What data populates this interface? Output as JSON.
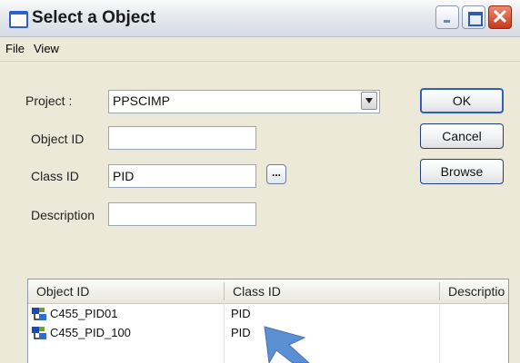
{
  "window": {
    "title": "Select a Object"
  },
  "menu": {
    "items": [
      "File",
      "View"
    ]
  },
  "form": {
    "project_label": "Project :",
    "project_value": "PPSCIMP",
    "object_id_label": "Object ID",
    "object_id_value": "",
    "class_id_label": "Class ID",
    "class_id_value": "PID",
    "description_label": "Description",
    "description_value": "",
    "ellipsis_label": "..."
  },
  "buttons": {
    "ok": "OK",
    "cancel": "Cancel",
    "browse": "Browse"
  },
  "list": {
    "columns": [
      "Object ID",
      "Class ID",
      "Descriptio"
    ],
    "rows": [
      {
        "object_id": "C455_PID01",
        "class_id": "PID",
        "description": ""
      },
      {
        "object_id": "C455_PID_100",
        "class_id": "PID",
        "description": ""
      }
    ]
  },
  "colors": {
    "window_face": "#ece9d8",
    "button_border": "#1f3f80",
    "close_button": "#c5391a",
    "pointer": "#5b8fd3"
  }
}
